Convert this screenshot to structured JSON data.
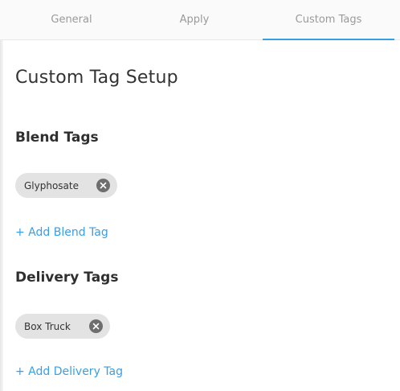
{
  "tabs": [
    {
      "label": "General",
      "active": false
    },
    {
      "label": "Apply",
      "active": false
    },
    {
      "label": "Custom Tags",
      "active": true
    }
  ],
  "page": {
    "title": "Custom Tag Setup"
  },
  "blend_tags": {
    "heading": "Blend Tags",
    "tags": [
      "Glyphosate"
    ],
    "add_label": "+ Add Blend Tag"
  },
  "delivery_tags": {
    "heading": "Delivery Tags",
    "tags": [
      "Box Truck"
    ],
    "add_label": "+ Add Delivery Tag"
  },
  "colors": {
    "accent": "#3a9ee4",
    "chip_background": "#e3e3e3",
    "chip_remove": "#6e6e6e"
  },
  "icons": {
    "tag_remove": "close-circle-icon"
  }
}
